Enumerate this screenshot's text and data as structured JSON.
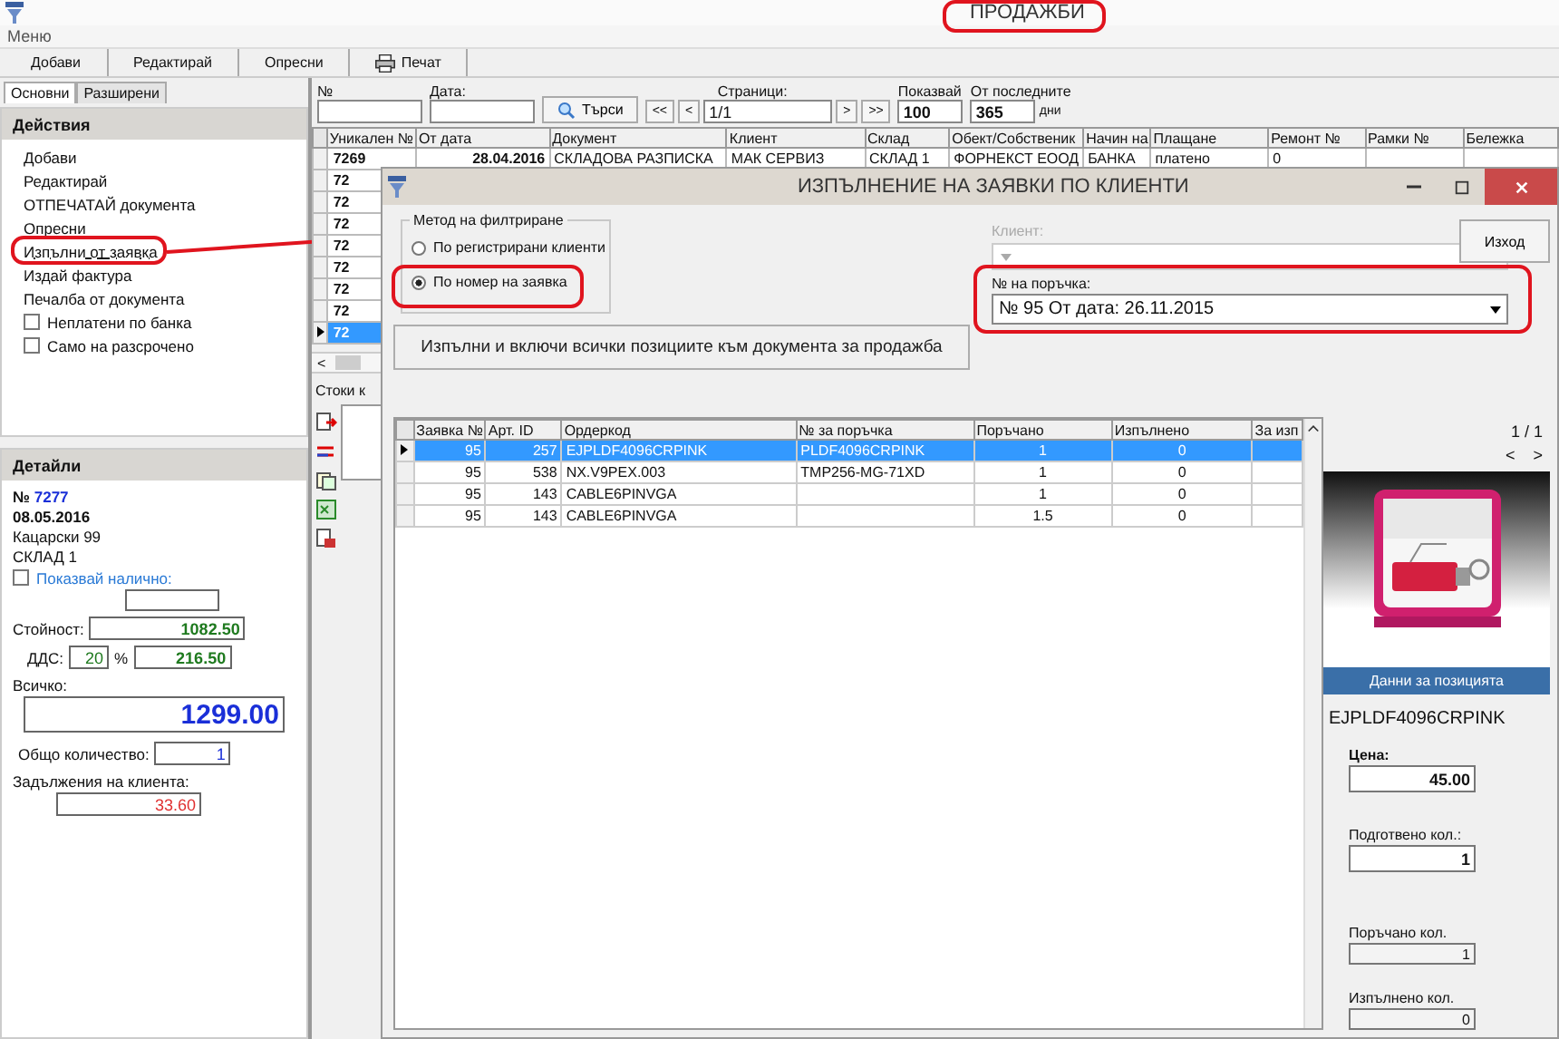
{
  "app": {
    "title": "ПРОДАЖБИ",
    "menu": "Меню"
  },
  "toolbar": [
    {
      "label": "Добави",
      "kind": "text"
    },
    {
      "label": "Редактирай",
      "kind": "text"
    },
    {
      "label": "Опресни",
      "kind": "text"
    },
    {
      "label": "Печат",
      "kind": "print"
    }
  ],
  "left_tabs": [
    {
      "label": "Основни",
      "selected": true
    },
    {
      "label": "Разширени",
      "selected": false
    }
  ],
  "actions": {
    "title": "Действия",
    "items": [
      {
        "label": "Добави",
        "kind": "link",
        "hovered": false
      },
      {
        "label": "Редактирай",
        "kind": "link",
        "hovered": false
      },
      {
        "label": "ОТПЕЧАТАЙ документа",
        "kind": "link",
        "hovered": false
      },
      {
        "label": "Опресни",
        "kind": "link",
        "hovered": false
      },
      {
        "label": "Изпълни от заявка",
        "kind": "link",
        "hovered": true
      },
      {
        "label": "Издай фактура",
        "kind": "link",
        "hovered": false
      },
      {
        "label": "Печалба от документа",
        "kind": "link",
        "hovered": false
      },
      {
        "label": "Неплатени по банка",
        "kind": "checkbox",
        "checked": false
      },
      {
        "label": "Само на разсрочено",
        "kind": "checkbox",
        "checked": false
      }
    ]
  },
  "details": {
    "title": "Детайли",
    "number_prefix": "№",
    "number": "7277",
    "date": "08.05.2016",
    "address": "Кацарски 99",
    "warehouse": "СКЛАД 1",
    "show_available": {
      "label": "Показвай налично:",
      "checked": false
    },
    "value": {
      "label": "Стойност:",
      "value": "1082.50"
    },
    "vat": {
      "label": "ДДС:",
      "rate": "20",
      "unit": "%",
      "value": "216.50"
    },
    "total": {
      "label": "Всичко:",
      "value": "1299.00"
    },
    "quantity": {
      "label": "Общо количество:",
      "value": "1"
    },
    "debt": {
      "label": "Задължения на клиента:",
      "value": "33.60"
    }
  },
  "filter": {
    "number_label": "№",
    "date_label": "Дата:",
    "search": "Търси",
    "pages_label": "Страници:",
    "first": "<<",
    "prev": "<",
    "page": "1/1",
    "next": ">",
    "last": ">>",
    "show_label": "Показвай",
    "show": "100",
    "last_label": "От последните",
    "days": "365",
    "days_unit": "дни"
  },
  "table": {
    "columns": [
      "Уникален №",
      "От дата",
      "Документ",
      "Клиент",
      "Склад",
      "Обект/Собственик",
      "Начин на",
      "Плащане",
      "Ремонт №",
      "Рамки №",
      "Бележка"
    ],
    "rows": [
      {
        "selected": false,
        "cells": [
          "7269",
          "28.04.2016",
          "СКЛАДОВА РАЗПИСКА",
          "МАК СЕРВИЗ",
          "СКЛАД 1",
          "ФОРНЕКСТ ЕООД",
          "БАНКА",
          "платено",
          "0",
          "",
          ""
        ]
      },
      {
        "selected": false,
        "cells": [
          "72"
        ]
      },
      {
        "selected": false,
        "cells": [
          "72"
        ]
      },
      {
        "selected": false,
        "cells": [
          "72"
        ]
      },
      {
        "selected": false,
        "cells": [
          "72"
        ]
      },
      {
        "selected": false,
        "cells": [
          "72"
        ]
      },
      {
        "selected": false,
        "cells": [
          "72"
        ]
      },
      {
        "selected": false,
        "cells": [
          "72"
        ]
      },
      {
        "selected": true,
        "cells": [
          "72"
        ]
      }
    ]
  },
  "lower": {
    "scroll_left": "<",
    "tab": "Стоки к"
  },
  "dialog": {
    "title": "ИЗПЪЛНЕНИЕ НА ЗАЯВКИ ПО КЛИЕНТИ",
    "method": {
      "title": "Метод на филтриране",
      "options": [
        {
          "label": "По регистрирани клиенти",
          "selected": false
        },
        {
          "label": "По номер на заявка",
          "selected": true
        }
      ]
    },
    "client": {
      "label": "Клиент:",
      "disabled": true
    },
    "order": {
      "label": "№ на поръчка:",
      "value": "№ 95  От дата: 26.11.2015"
    },
    "execute": "Изпълни и включи всички позициите към документа за продажба",
    "exit": "Изход",
    "columns": [
      "Заявка №",
      "Арт. ID",
      "Ордеркод",
      "№ за поръчка",
      "Поръчано",
      "Изпълнено",
      "За изп"
    ],
    "rows": [
      {
        "selected": true,
        "cells": [
          "95",
          "257",
          "EJPLDF4096CRPINK",
          "PLDF4096CRPINK",
          "1",
          "0",
          ""
        ]
      },
      {
        "selected": false,
        "cells": [
          "95",
          "538",
          "NX.V9PEX.003",
          "TMP256-MG-71XD",
          "1",
          "0",
          ""
        ]
      },
      {
        "selected": false,
        "cells": [
          "95",
          "143",
          "CABLE6PINVGA",
          "",
          "1",
          "0",
          ""
        ]
      },
      {
        "selected": false,
        "cells": [
          "95",
          "143",
          "CABLE6PINVGA",
          "",
          "1.5",
          "0",
          ""
        ]
      }
    ],
    "side": {
      "pager": "1 / 1",
      "prev": "<",
      "next": ">",
      "section": "Данни за позицията",
      "code": "EJPLDF4096CRPINK",
      "fields": [
        {
          "label": "Цена:",
          "value": "45.00",
          "kind": "main"
        },
        {
          "label": "Подготвено кол.:",
          "value": "1",
          "kind": "main"
        },
        {
          "label": "Поръчано кол.",
          "value": "1",
          "kind": "minor"
        },
        {
          "label": "Изпълнено кол.",
          "value": "0",
          "kind": "minor"
        }
      ]
    }
  }
}
